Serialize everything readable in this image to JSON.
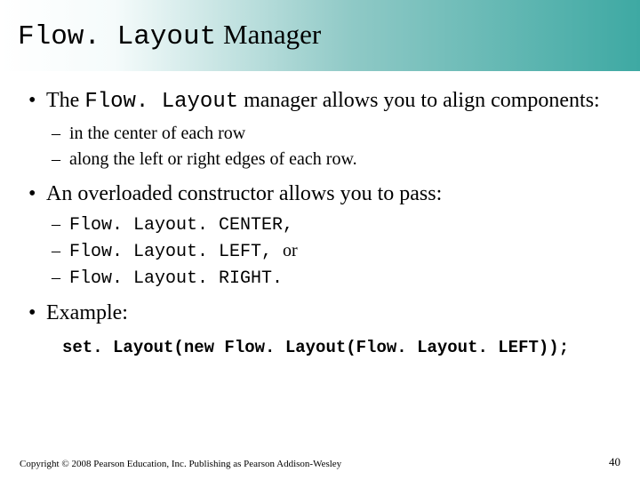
{
  "title": {
    "code_part": "Flow. Layout",
    "text_part": " Manager"
  },
  "bullets": {
    "b1_pre": "The ",
    "b1_code": "Flow. Layout",
    "b1_post": " manager allows you to align components:",
    "b1_sub1": "in the center of each row",
    "b1_sub2": "along the left or right edges of each row.",
    "b2": "An overloaded constructor allows you to pass:",
    "b2_sub1": "Flow. Layout. CENTER,",
    "b2_sub2": "Flow. Layout. LEFT, ",
    "b2_sub2_tail": "or",
    "b2_sub3": "Flow. Layout. RIGHT.",
    "b3": "Example:"
  },
  "example_code": "set. Layout(new Flow. Layout(Flow. Layout. LEFT));",
  "footer": "Copyright © 2008 Pearson Education, Inc. Publishing as Pearson Addison-Wesley",
  "page_number": "40"
}
